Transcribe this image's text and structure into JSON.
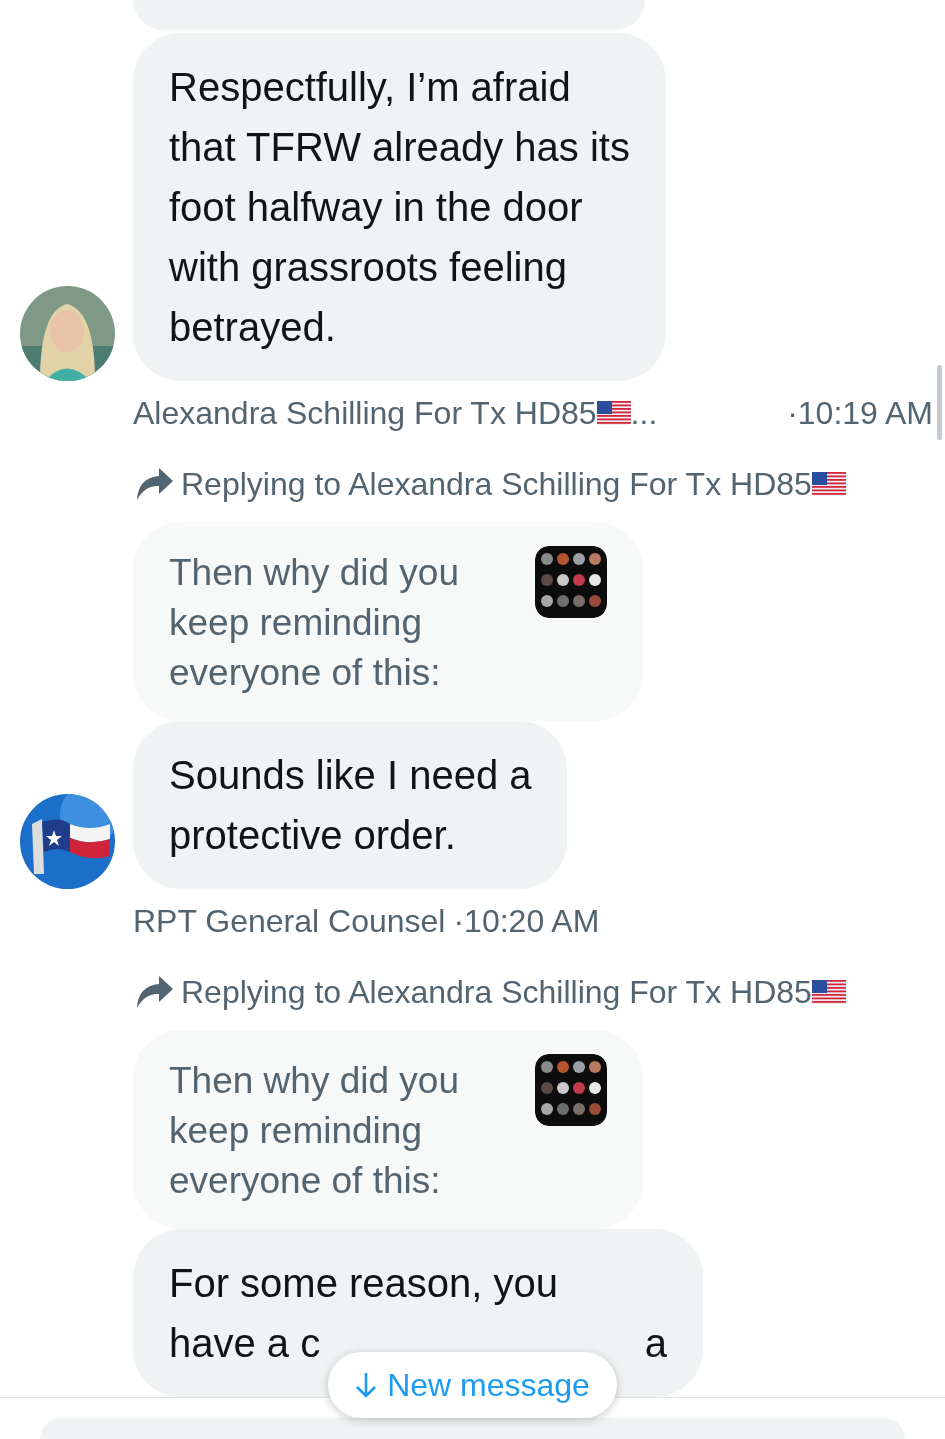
{
  "conversation": {
    "messages": [
      {
        "text_lines": [
          "Respectfully, I’m afraid",
          "that TFRW already has its",
          "foot halfway in the door",
          "with grassroots feeling",
          "betrayed."
        ],
        "avatar": {
          "kind": "picture"
        },
        "author": "Alexandra Schilling For Tx HD85",
        "author_flag": true,
        "author_cut": "...",
        "time": "·10:19 AM"
      },
      {
        "reply_to": "Replying to Alexandra Schilling For Tx HD85",
        "reply_flag": true,
        "quote": {
          "text_lines": [
            "Then why did you",
            "keep reminding",
            "everyone of this:"
          ],
          "thumbnail": {
            "kind": "picture"
          }
        },
        "text_lines": [
          "Sounds like I need a",
          "protective order."
        ],
        "avatar": {
          "kind": "picture"
        },
        "author": "RPT General Counsel",
        "time": "·10:20 AM"
      },
      {
        "reply_to": "Replying to Alexandra Schilling For Tx HD85",
        "reply_flag": true,
        "quote": {
          "text_lines": [
            "Then why did you",
            "keep reminding",
            "everyone of this:"
          ],
          "thumbnail": {
            "kind": "picture"
          }
        },
        "text_lines": [
          "For some reason, you",
          "have a c"
        ],
        "text_tail": "a"
      }
    ]
  },
  "new_message_button": {
    "label": "New message"
  }
}
